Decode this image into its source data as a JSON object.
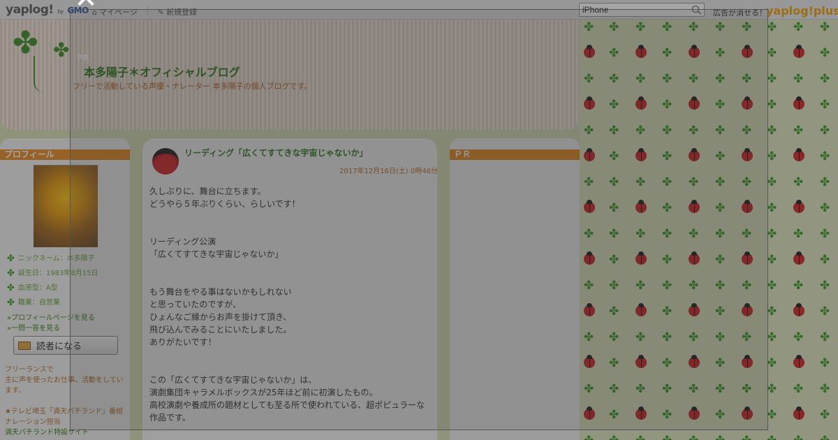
{
  "topbar": {
    "logo_text": "yaplog!",
    "logo_by": "by",
    "logo_gmo": "GMO",
    "mypage_label": "マイページ",
    "signup_label": "新規登録",
    "search_value": "iPhone",
    "ad_remove_label": "広告が消せる！",
    "plus_logo": "yaplog!plus"
  },
  "header": {
    "pr_label": "PR",
    "blog_title": "本多陽子＊オフィシャルブログ",
    "blog_subtitle": "フリーで活動している声優・ナレーター 本多陽子の個人ブログです。"
  },
  "sidebar_left": {
    "heading": "プロフィール",
    "items": [
      "ニックネーム：本多陽子",
      "誕生日：1983年8月15日",
      "血液型：A型",
      "職業：自営業"
    ],
    "profile_link": "»プロフィールページを見る",
    "qa_link": "»一問一答を見る",
    "reader_button": "読者になる",
    "bio_line1": "フリーランスで",
    "bio_line2": "主に声を使ったお仕事、活動をしています。",
    "program_line": "★テレビ埼玉「満天パチランド」番組ナレーション担当",
    "program_link": "満天パチランド特設サイト"
  },
  "entry": {
    "title": "リーディング「広くてすてきな宇宙じゃないか」",
    "date": "2017年12月16日(土) 0時46分",
    "p1_line1": "久しぶりに、舞台に立ちます。",
    "p1_line2": "どうやら５年ぶりくらい、らしいです！",
    "p2_line1": "リーディング公演",
    "p2_line2": "「広くてすてきな宇宙じゃないか」",
    "p3_line1": "もう舞台をやる事はないかもしれない",
    "p3_line2": "と思っていたのですが、",
    "p3_line3": "ひょんなご縁からお声を掛けて頂き、",
    "p3_line4": "飛び込んでみることにいたしました。",
    "p3_line5": "ありがたいです！",
    "p4_line1": "この「広くてすてきな宇宙じゃないか」は、",
    "p4_line2": "演劇集団キャラメルボックスが25年ほど前に初演したもの。",
    "p4_line3": "高校演劇や養成所の題材としても至る所で使われている、超ポピュラーな",
    "p4_line4": "作品です。"
  },
  "sidebar_right": {
    "heading": "ＰＲ"
  },
  "colors": {
    "accent_orange": "#e88a24",
    "title_green": "#2e7a20",
    "overlay": "rgba(40,40,40,0.42)"
  }
}
